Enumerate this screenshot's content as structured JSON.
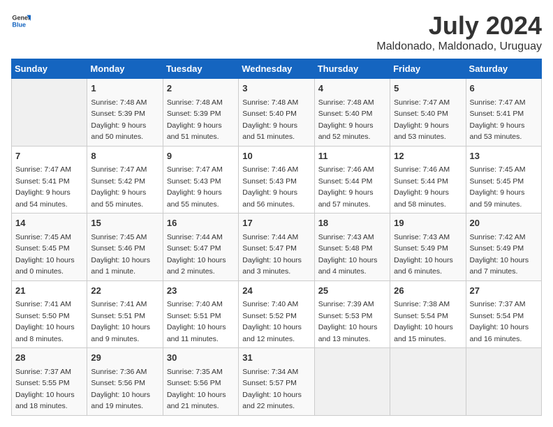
{
  "logo": {
    "general": "General",
    "blue": "Blue"
  },
  "title": "July 2024",
  "subtitle": "Maldonado, Maldonado, Uruguay",
  "days": [
    "Sunday",
    "Monday",
    "Tuesday",
    "Wednesday",
    "Thursday",
    "Friday",
    "Saturday"
  ],
  "weeks": [
    [
      {
        "date": "",
        "sunrise": "",
        "sunset": "",
        "daylight": ""
      },
      {
        "date": "1",
        "sunrise": "Sunrise: 7:48 AM",
        "sunset": "Sunset: 5:39 PM",
        "daylight": "Daylight: 9 hours and 50 minutes."
      },
      {
        "date": "2",
        "sunrise": "Sunrise: 7:48 AM",
        "sunset": "Sunset: 5:39 PM",
        "daylight": "Daylight: 9 hours and 51 minutes."
      },
      {
        "date": "3",
        "sunrise": "Sunrise: 7:48 AM",
        "sunset": "Sunset: 5:40 PM",
        "daylight": "Daylight: 9 hours and 51 minutes."
      },
      {
        "date": "4",
        "sunrise": "Sunrise: 7:48 AM",
        "sunset": "Sunset: 5:40 PM",
        "daylight": "Daylight: 9 hours and 52 minutes."
      },
      {
        "date": "5",
        "sunrise": "Sunrise: 7:47 AM",
        "sunset": "Sunset: 5:40 PM",
        "daylight": "Daylight: 9 hours and 53 minutes."
      },
      {
        "date": "6",
        "sunrise": "Sunrise: 7:47 AM",
        "sunset": "Sunset: 5:41 PM",
        "daylight": "Daylight: 9 hours and 53 minutes."
      }
    ],
    [
      {
        "date": "7",
        "sunrise": "Sunrise: 7:47 AM",
        "sunset": "Sunset: 5:41 PM",
        "daylight": "Daylight: 9 hours and 54 minutes."
      },
      {
        "date": "8",
        "sunrise": "Sunrise: 7:47 AM",
        "sunset": "Sunset: 5:42 PM",
        "daylight": "Daylight: 9 hours and 55 minutes."
      },
      {
        "date": "9",
        "sunrise": "Sunrise: 7:47 AM",
        "sunset": "Sunset: 5:43 PM",
        "daylight": "Daylight: 9 hours and 55 minutes."
      },
      {
        "date": "10",
        "sunrise": "Sunrise: 7:46 AM",
        "sunset": "Sunset: 5:43 PM",
        "daylight": "Daylight: 9 hours and 56 minutes."
      },
      {
        "date": "11",
        "sunrise": "Sunrise: 7:46 AM",
        "sunset": "Sunset: 5:44 PM",
        "daylight": "Daylight: 9 hours and 57 minutes."
      },
      {
        "date": "12",
        "sunrise": "Sunrise: 7:46 AM",
        "sunset": "Sunset: 5:44 PM",
        "daylight": "Daylight: 9 hours and 58 minutes."
      },
      {
        "date": "13",
        "sunrise": "Sunrise: 7:45 AM",
        "sunset": "Sunset: 5:45 PM",
        "daylight": "Daylight: 9 hours and 59 minutes."
      }
    ],
    [
      {
        "date": "14",
        "sunrise": "Sunrise: 7:45 AM",
        "sunset": "Sunset: 5:45 PM",
        "daylight": "Daylight: 10 hours and 0 minutes."
      },
      {
        "date": "15",
        "sunrise": "Sunrise: 7:45 AM",
        "sunset": "Sunset: 5:46 PM",
        "daylight": "Daylight: 10 hours and 1 minute."
      },
      {
        "date": "16",
        "sunrise": "Sunrise: 7:44 AM",
        "sunset": "Sunset: 5:47 PM",
        "daylight": "Daylight: 10 hours and 2 minutes."
      },
      {
        "date": "17",
        "sunrise": "Sunrise: 7:44 AM",
        "sunset": "Sunset: 5:47 PM",
        "daylight": "Daylight: 10 hours and 3 minutes."
      },
      {
        "date": "18",
        "sunrise": "Sunrise: 7:43 AM",
        "sunset": "Sunset: 5:48 PM",
        "daylight": "Daylight: 10 hours and 4 minutes."
      },
      {
        "date": "19",
        "sunrise": "Sunrise: 7:43 AM",
        "sunset": "Sunset: 5:49 PM",
        "daylight": "Daylight: 10 hours and 6 minutes."
      },
      {
        "date": "20",
        "sunrise": "Sunrise: 7:42 AM",
        "sunset": "Sunset: 5:49 PM",
        "daylight": "Daylight: 10 hours and 7 minutes."
      }
    ],
    [
      {
        "date": "21",
        "sunrise": "Sunrise: 7:41 AM",
        "sunset": "Sunset: 5:50 PM",
        "daylight": "Daylight: 10 hours and 8 minutes."
      },
      {
        "date": "22",
        "sunrise": "Sunrise: 7:41 AM",
        "sunset": "Sunset: 5:51 PM",
        "daylight": "Daylight: 10 hours and 9 minutes."
      },
      {
        "date": "23",
        "sunrise": "Sunrise: 7:40 AM",
        "sunset": "Sunset: 5:51 PM",
        "daylight": "Daylight: 10 hours and 11 minutes."
      },
      {
        "date": "24",
        "sunrise": "Sunrise: 7:40 AM",
        "sunset": "Sunset: 5:52 PM",
        "daylight": "Daylight: 10 hours and 12 minutes."
      },
      {
        "date": "25",
        "sunrise": "Sunrise: 7:39 AM",
        "sunset": "Sunset: 5:53 PM",
        "daylight": "Daylight: 10 hours and 13 minutes."
      },
      {
        "date": "26",
        "sunrise": "Sunrise: 7:38 AM",
        "sunset": "Sunset: 5:54 PM",
        "daylight": "Daylight: 10 hours and 15 minutes."
      },
      {
        "date": "27",
        "sunrise": "Sunrise: 7:37 AM",
        "sunset": "Sunset: 5:54 PM",
        "daylight": "Daylight: 10 hours and 16 minutes."
      }
    ],
    [
      {
        "date": "28",
        "sunrise": "Sunrise: 7:37 AM",
        "sunset": "Sunset: 5:55 PM",
        "daylight": "Daylight: 10 hours and 18 minutes."
      },
      {
        "date": "29",
        "sunrise": "Sunrise: 7:36 AM",
        "sunset": "Sunset: 5:56 PM",
        "daylight": "Daylight: 10 hours and 19 minutes."
      },
      {
        "date": "30",
        "sunrise": "Sunrise: 7:35 AM",
        "sunset": "Sunset: 5:56 PM",
        "daylight": "Daylight: 10 hours and 21 minutes."
      },
      {
        "date": "31",
        "sunrise": "Sunrise: 7:34 AM",
        "sunset": "Sunset: 5:57 PM",
        "daylight": "Daylight: 10 hours and 22 minutes."
      },
      {
        "date": "",
        "sunrise": "",
        "sunset": "",
        "daylight": ""
      },
      {
        "date": "",
        "sunrise": "",
        "sunset": "",
        "daylight": ""
      },
      {
        "date": "",
        "sunrise": "",
        "sunset": "",
        "daylight": ""
      }
    ]
  ]
}
